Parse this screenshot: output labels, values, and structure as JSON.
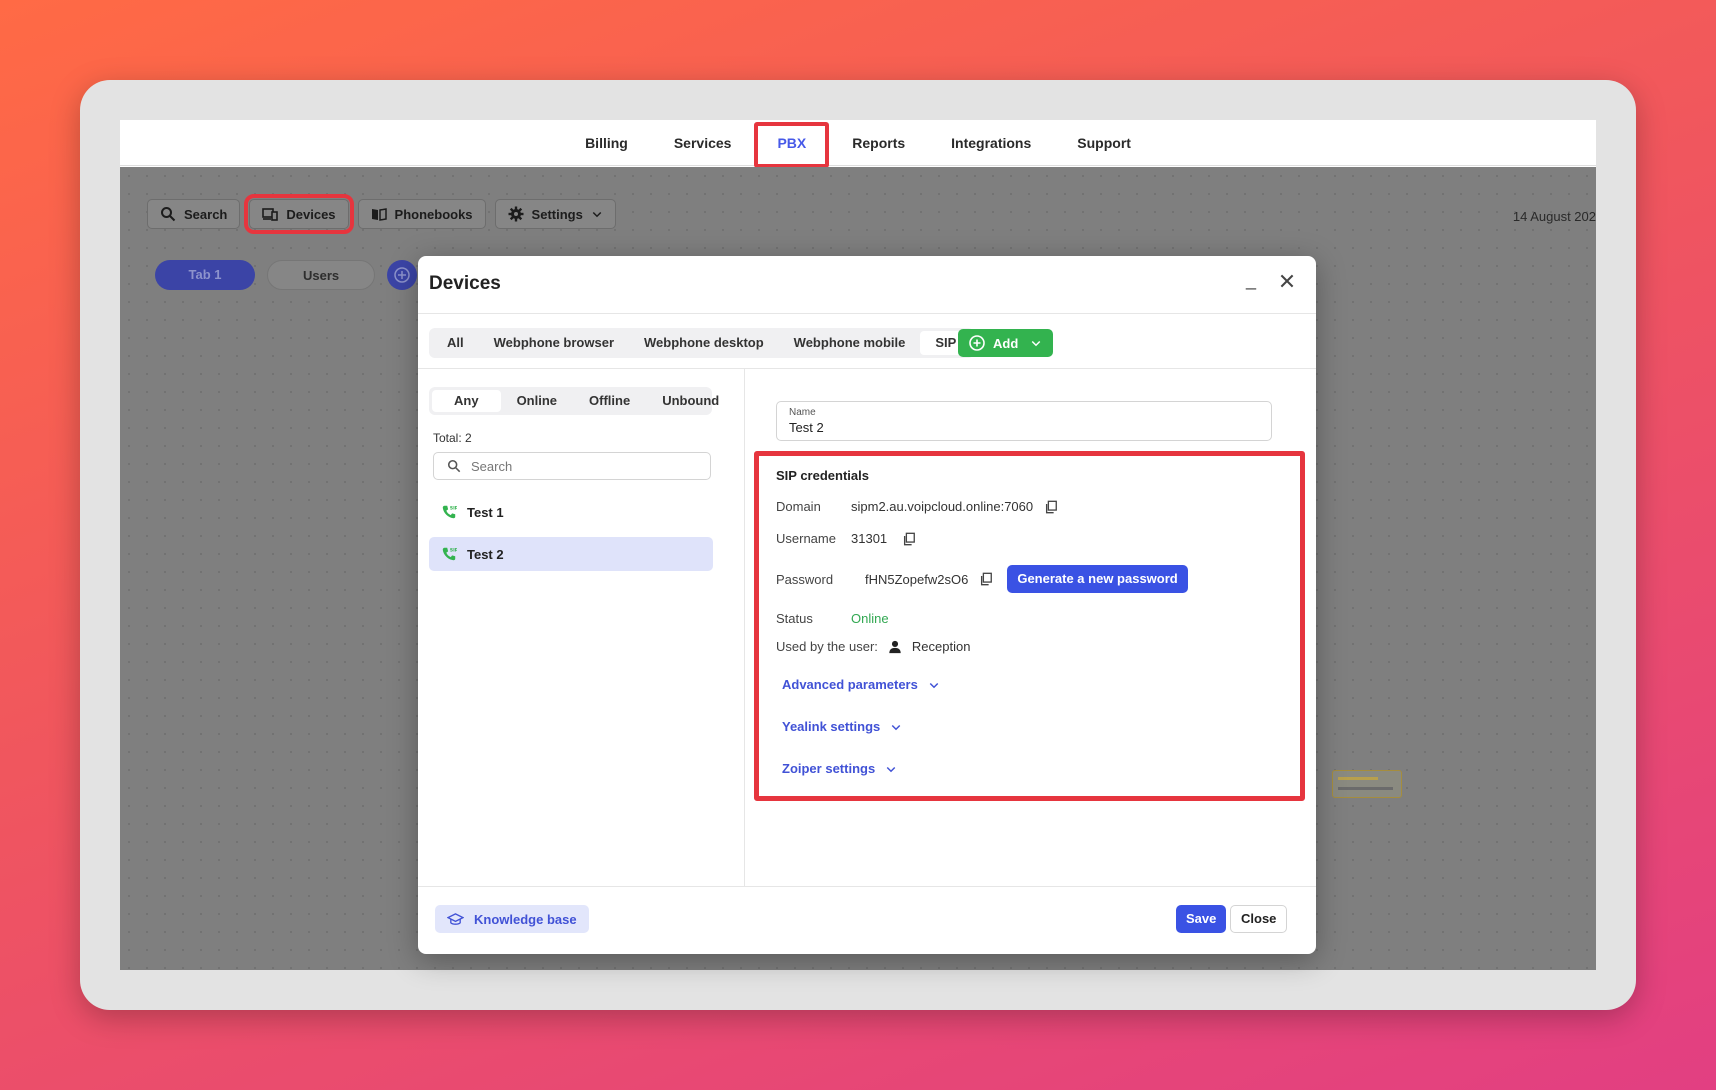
{
  "nav": {
    "items": [
      {
        "label": "Billing"
      },
      {
        "label": "Services"
      },
      {
        "label": "PBX"
      },
      {
        "label": "Reports"
      },
      {
        "label": "Integrations"
      },
      {
        "label": "Support"
      }
    ],
    "active": "PBX"
  },
  "toolbar": {
    "search": "Search",
    "devices": "Devices",
    "phonebooks": "Phonebooks",
    "settings": "Settings",
    "date": "14 August 202"
  },
  "canvas_tabs": {
    "tab1": "Tab 1",
    "users": "Users"
  },
  "modal": {
    "title": "Devices",
    "minimize": "_",
    "type_tabs": [
      "All",
      "Webphone browser",
      "Webphone desktop",
      "Webphone mobile",
      "SIP"
    ],
    "active_type": "SIP",
    "add_label": "Add",
    "status_tabs": [
      "Any",
      "Online",
      "Offline",
      "Unbound"
    ],
    "active_status": "Any",
    "total": "Total: 2",
    "search_placeholder": "Search",
    "devices": [
      {
        "name": "Test 1"
      },
      {
        "name": "Test 2"
      }
    ],
    "selected_device": "Test 2",
    "name_field": {
      "label": "Name",
      "value": "Test 2"
    },
    "sip": {
      "title": "SIP credentials",
      "domain_label": "Domain",
      "domain": "sipm2.au.voipcloud.online:7060",
      "username_label": "Username",
      "username": "31301",
      "password_label": "Password",
      "password": "fHN5Zopefw2sO6",
      "generate_label": "Generate a new password",
      "status_label": "Status",
      "status": "Online",
      "used_by_label": "Used by the user:",
      "used_by": "Reception",
      "advanced": "Advanced parameters",
      "yealink": "Yealink settings",
      "zoiper": "Zoiper settings"
    },
    "footer": {
      "knowledge_base": "Knowledge base",
      "save": "Save",
      "close": "Close"
    }
  },
  "colors": {
    "accent": "#3a52e4",
    "highlight": "#e6353e",
    "online": "#32a852",
    "add_green": "#33b34f"
  }
}
